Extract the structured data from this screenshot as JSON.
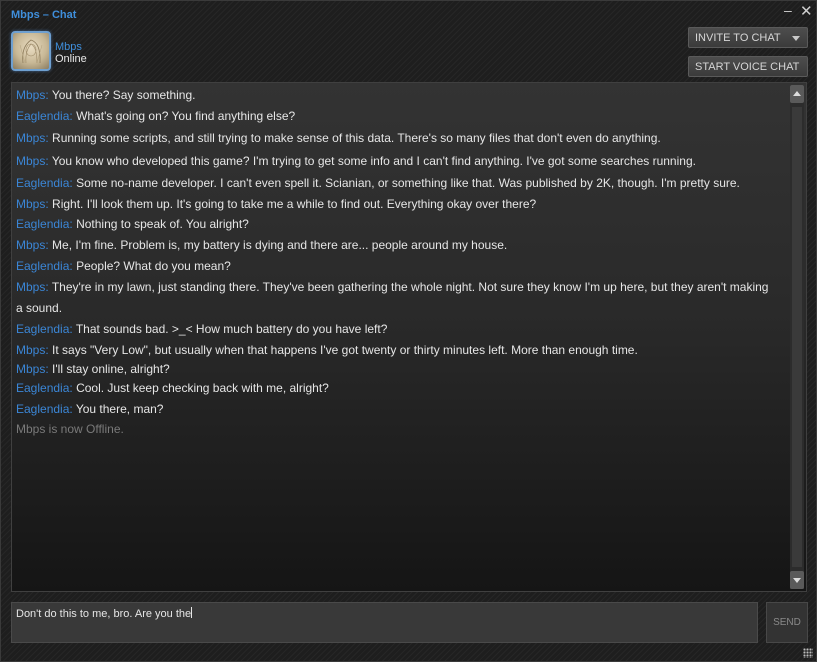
{
  "window": {
    "title": "Mbps – Chat",
    "minimize_icon": "minimize-icon",
    "close_icon": "close-icon",
    "minimize_glyph": "–",
    "close_glyph": "✕"
  },
  "contact": {
    "name": "Mbps",
    "status": "Online",
    "avatar_icon": "avatar-sketch-portrait"
  },
  "toolbar": {
    "invite_label": "INVITE TO CHAT",
    "voice_label": "START VOICE CHAT"
  },
  "colors": {
    "accent": "#3b86d6",
    "text": "#e6e6e6",
    "system_text": "#7a7a7a"
  },
  "messages": [
    {
      "sender": "Mbps:",
      "text": "You there? Say something."
    },
    {
      "sender": "Eaglendia:",
      "text": "What's going on? You find anything else?"
    },
    {
      "sender": "Mbps:",
      "text": "Running some scripts, and still trying to make sense of this data. There's so many files that don't even do anything."
    },
    {
      "sender": "Mbps:",
      "text": "You know who developed this game? I'm trying to get some info and I can't find anything. I've got some searches running."
    },
    {
      "sender": "Eaglendia:",
      "text": "Some no-name developer. I can't even spell it. Scianian, or something like that. Was published by 2K, though. I'm pretty sure."
    },
    {
      "sender": "Mbps:",
      "text": "Right. I'll look them up. It's going to take me a while to find out. Everything okay over there?"
    },
    {
      "sender": "Eaglendia:",
      "text": "Nothing to speak of. You alright?"
    },
    {
      "sender": "Mbps:",
      "text": "Me, I'm fine. Problem is, my battery is dying and there are... people around my house."
    },
    {
      "sender": "Eaglendia:",
      "text": "People? What do you mean?"
    },
    {
      "sender": "Mbps:",
      "text": "They're in my lawn, just standing there. They've been gathering the whole night. Not sure they know I'm up here, but they aren't making a sound."
    },
    {
      "sender": "Eaglendia:",
      "text": "That sounds bad. >_< How much battery do you have left?"
    },
    {
      "sender": "Mbps:",
      "text": "It says \"Very Low\", but usually when that happens I've got twenty or thirty minutes left. More than enough time."
    },
    {
      "sender": "Mbps:",
      "text": "I'll stay online, alright?"
    },
    {
      "sender": "Eaglendia:",
      "text": "Cool. Just keep checking back with me, alright?"
    },
    {
      "sender": "Eaglendia:",
      "text": "You there, man?"
    }
  ],
  "system_message": "Mbps is now Offline.",
  "composer": {
    "value": "Don't do this to me, bro. Are you the",
    "send_label": "SEND"
  }
}
